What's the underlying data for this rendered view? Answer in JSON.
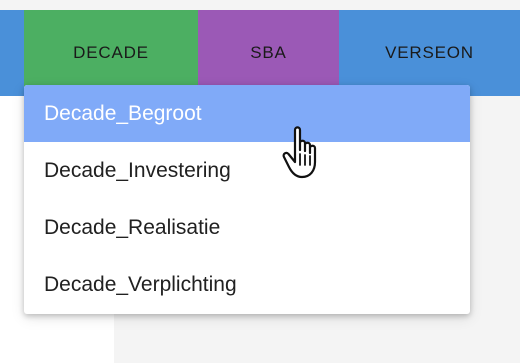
{
  "colors": {
    "decade_tab": "#4caf62",
    "sba_tab": "#9b59b6",
    "verseon_tab": "#4a90d9",
    "highlight": "#80aaf8"
  },
  "tabs": [
    {
      "label": "DECADE"
    },
    {
      "label": "SBA"
    },
    {
      "label": "VERSEON"
    }
  ],
  "dropdown": {
    "items": [
      {
        "label": "Decade_Begroot",
        "highlighted": true
      },
      {
        "label": "Decade_Investering",
        "highlighted": false
      },
      {
        "label": "Decade_Realisatie",
        "highlighted": false
      },
      {
        "label": "Decade_Verplichting",
        "highlighted": false
      }
    ]
  },
  "cursor": {
    "icon": "hand-pointer-icon"
  }
}
